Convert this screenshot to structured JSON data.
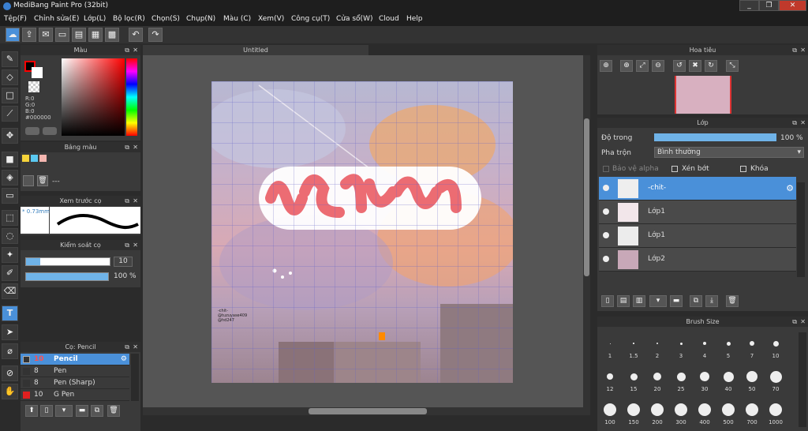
{
  "app": {
    "title": "MediBang Paint Pro (32bit)"
  },
  "menu": [
    "Tệp(F)",
    "Chỉnh sửa(E)",
    "Lớp(L)",
    "Bộ lọc(R)",
    "Chọn(S)",
    "Chụp(N)",
    "Màu (C)",
    "Xem(V)",
    "Công cụ(T)",
    "Cửa sổ(W)",
    "Cloud",
    "Help"
  ],
  "document": {
    "tab": "Untitled"
  },
  "color_panel": {
    "title": "Màu",
    "rgb": [
      "R:0",
      "G:0",
      "B:0"
    ],
    "hex": "#000000",
    "primary": "#000000",
    "secondary": "#ffffff",
    "accent": "#ff0000"
  },
  "palette_panel": {
    "title": "Bảng màu",
    "swatches": [
      "#f5d33a",
      "#5ac8f0",
      "#f4b6b0"
    ],
    "dash": "---"
  },
  "brush_preview": {
    "title": "Xem trước cọ",
    "size": "* 0.73mm"
  },
  "brush_control": {
    "title": "Kiểm soát cọ",
    "size": "10",
    "opacity": "100 %"
  },
  "brush_list": {
    "title": "Cọ: Pencil",
    "items": [
      {
        "size": "10",
        "name": "Pencil",
        "color": "#ff3030"
      },
      {
        "size": "8",
        "name": "Pen",
        "color": "#333333"
      },
      {
        "size": "8",
        "name": "Pen (Sharp)",
        "color": "#333333"
      },
      {
        "size": "10",
        "name": "G Pen",
        "color": "#ff3030"
      }
    ]
  },
  "navigator": {
    "title": "Hoa tiêu"
  },
  "layers": {
    "title": "Lớp",
    "opacity_label": "Độ trong",
    "opacity": "100 %",
    "blend_label": "Pha trộn",
    "blend": "Bình thường",
    "protect_alpha": "Bảo vệ alpha",
    "clipping": "Xén bớt",
    "lock": "Khóa",
    "items": [
      {
        "name": "-chit-"
      },
      {
        "name": "Lớp1"
      },
      {
        "name": "Lớp1"
      },
      {
        "name": "Lớp2"
      }
    ]
  },
  "brush_size": {
    "title": "Brush Size",
    "sizes": [
      "1",
      "1.5",
      "2",
      "3",
      "4",
      "5",
      "7",
      "10",
      "12",
      "15",
      "20",
      "25",
      "30",
      "40",
      "50",
      "70",
      "100",
      "150",
      "200",
      "300",
      "400",
      "500",
      "700",
      "1000"
    ]
  },
  "artwork": {
    "lines": [
      "-chit-",
      "@tuzuyase409",
      "@hd247"
    ]
  }
}
